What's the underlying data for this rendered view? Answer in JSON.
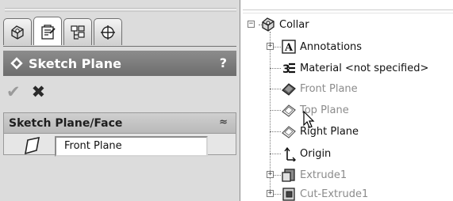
{
  "property_manager": {
    "tabs": [
      {
        "icon": "feature-manager-icon"
      },
      {
        "icon": "property-manager-icon"
      },
      {
        "icon": "configuration-manager-icon"
      },
      {
        "icon": "dimxpert-manager-icon"
      }
    ],
    "active_tab": 1,
    "title": "Sketch Plane",
    "help": "?",
    "ok_glyph": "✔",
    "cancel_glyph": "✖",
    "group": {
      "title": "Sketch Plane/Face",
      "collapse_glyph": "≈",
      "selection_value": "Front Plane"
    }
  },
  "feature_tree": {
    "root": {
      "label": "Collar",
      "expander": "−"
    },
    "items": [
      {
        "label": "Annotations",
        "icon": "annotations-icon",
        "expander": "+",
        "dim": false
      },
      {
        "label": "Material <not specified>",
        "icon": "material-icon",
        "expander": "",
        "dim": false
      },
      {
        "label": "Front Plane",
        "icon": "plane-selected-icon",
        "expander": "",
        "dim": true
      },
      {
        "label": "Top Plane",
        "icon": "plane-icon",
        "expander": "",
        "dim": true
      },
      {
        "label": "Right Plane",
        "icon": "plane-icon",
        "expander": "",
        "dim": false
      },
      {
        "label": "Origin",
        "icon": "origin-icon",
        "expander": "",
        "dim": false
      },
      {
        "label": "Extrude1",
        "icon": "extrude-icon",
        "expander": "+",
        "dim": true
      },
      {
        "label": "Cut-Extrude1",
        "icon": "cut-extrude-icon",
        "expander": "+",
        "dim": true
      }
    ]
  },
  "colors": {
    "header_bg": "#7a7a7a",
    "panel_bg": "#dcdcdc",
    "dim_text": "#8b8b8b"
  }
}
